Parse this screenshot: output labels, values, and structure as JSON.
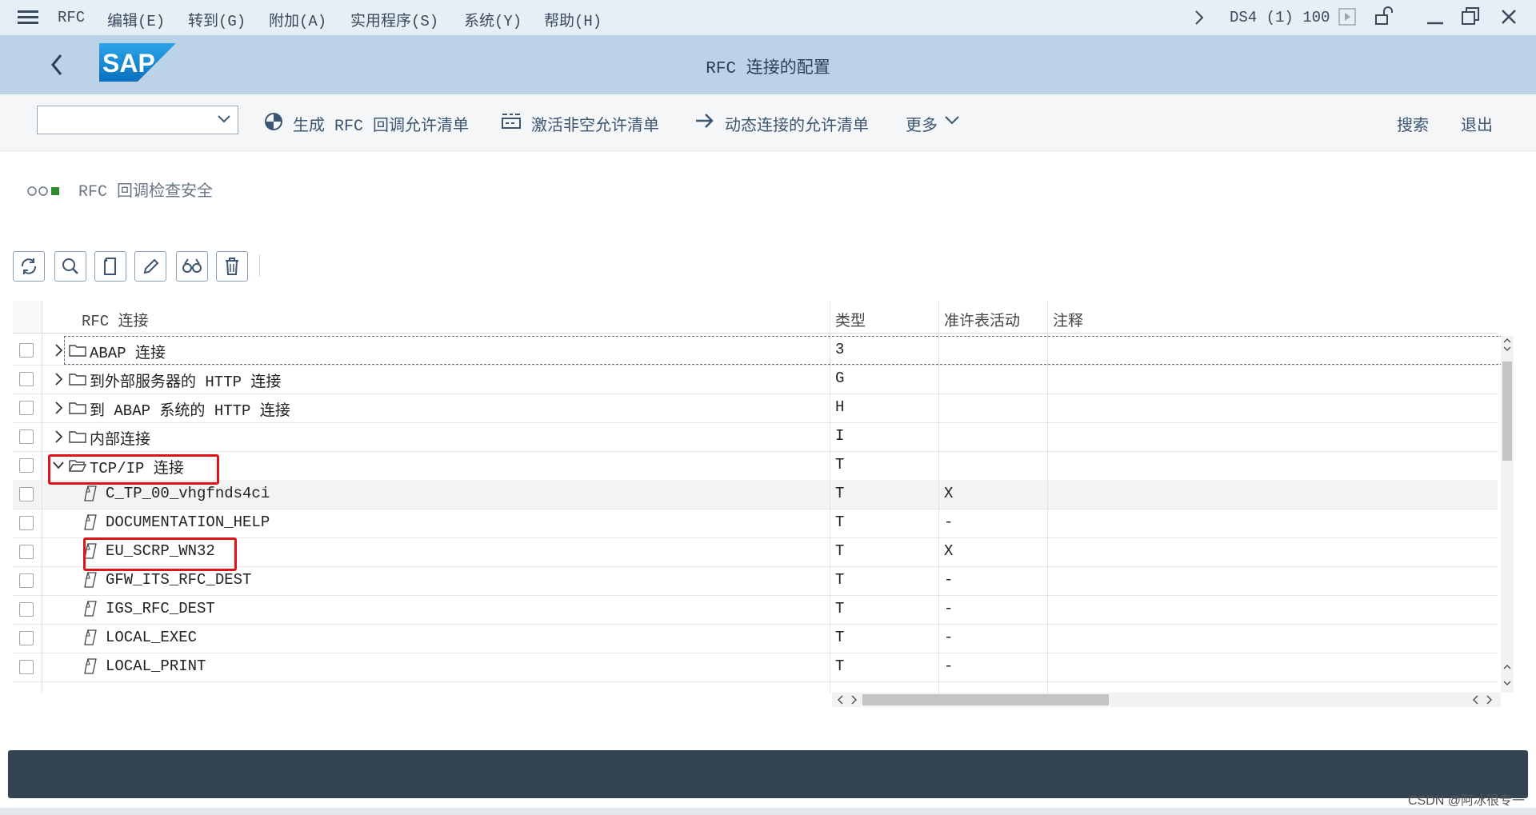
{
  "menubar": {
    "items": [
      "RFC",
      "编辑(E)",
      "转到(G)",
      "附加(A)",
      "实用程序(S)",
      "系统(Y)",
      "帮助(H)"
    ],
    "system_info": "DS4 (1) 100"
  },
  "titlebar": {
    "title": "RFC 连接的配置",
    "logo_text": "SAP"
  },
  "toolbar": {
    "select_value": "",
    "btn_generate": "生成 RFC 回调允许清单",
    "btn_activate": "激活非空允许清单",
    "btn_dynamic": "动态连接的允许清单",
    "btn_more": "更多",
    "btn_search": "搜索",
    "btn_exit": "退出"
  },
  "section": {
    "label": "RFC 回调检查安全",
    "status_colors": [
      "#ffffff",
      "#ffffff",
      "#2e8b2e"
    ]
  },
  "table": {
    "headers": [
      "RFC 连接",
      "类型",
      "准许表活动",
      "注释"
    ],
    "rows": [
      {
        "name": "ABAP 连接",
        "type": "3",
        "active": "",
        "comment": "",
        "kind": "folder",
        "expanded": false
      },
      {
        "name": "到外部服务器的 HTTP 连接",
        "type": "G",
        "active": "",
        "comment": "",
        "kind": "folder",
        "expanded": false
      },
      {
        "name": "到 ABAP 系统的 HTTP 连接",
        "type": "H",
        "active": "",
        "comment": "",
        "kind": "folder",
        "expanded": false
      },
      {
        "name": "内部连接",
        "type": "I",
        "active": "",
        "comment": "",
        "kind": "folder",
        "expanded": false
      },
      {
        "name": "TCP/IP 连接",
        "type": "T",
        "active": "",
        "comment": "",
        "kind": "folder",
        "expanded": true
      },
      {
        "name": "C_TP_00_vhgfnds4ci",
        "type": "T",
        "active": "X",
        "comment": "",
        "kind": "leaf"
      },
      {
        "name": "DOCUMENTATION_HELP",
        "type": "T",
        "active": "-",
        "comment": "",
        "kind": "leaf"
      },
      {
        "name": "EU_SCRP_WN32",
        "type": "T",
        "active": "X",
        "comment": "",
        "kind": "leaf"
      },
      {
        "name": "GFW_ITS_RFC_DEST",
        "type": "T",
        "active": "-",
        "comment": "",
        "kind": "leaf"
      },
      {
        "name": "IGS_RFC_DEST",
        "type": "T",
        "active": "-",
        "comment": "",
        "kind": "leaf"
      },
      {
        "name": "LOCAL_EXEC",
        "type": "T",
        "active": "-",
        "comment": "",
        "kind": "leaf"
      },
      {
        "name": "LOCAL_PRINT",
        "type": "T",
        "active": "-",
        "comment": "",
        "kind": "leaf"
      }
    ]
  },
  "watermark": "CSDN @阿冰很专一",
  "colors": {
    "title_bg": "#bcd2e6",
    "menu_bg": "#e6eef6",
    "highlight_red": "#e0131b",
    "status_bar": "#354453"
  }
}
